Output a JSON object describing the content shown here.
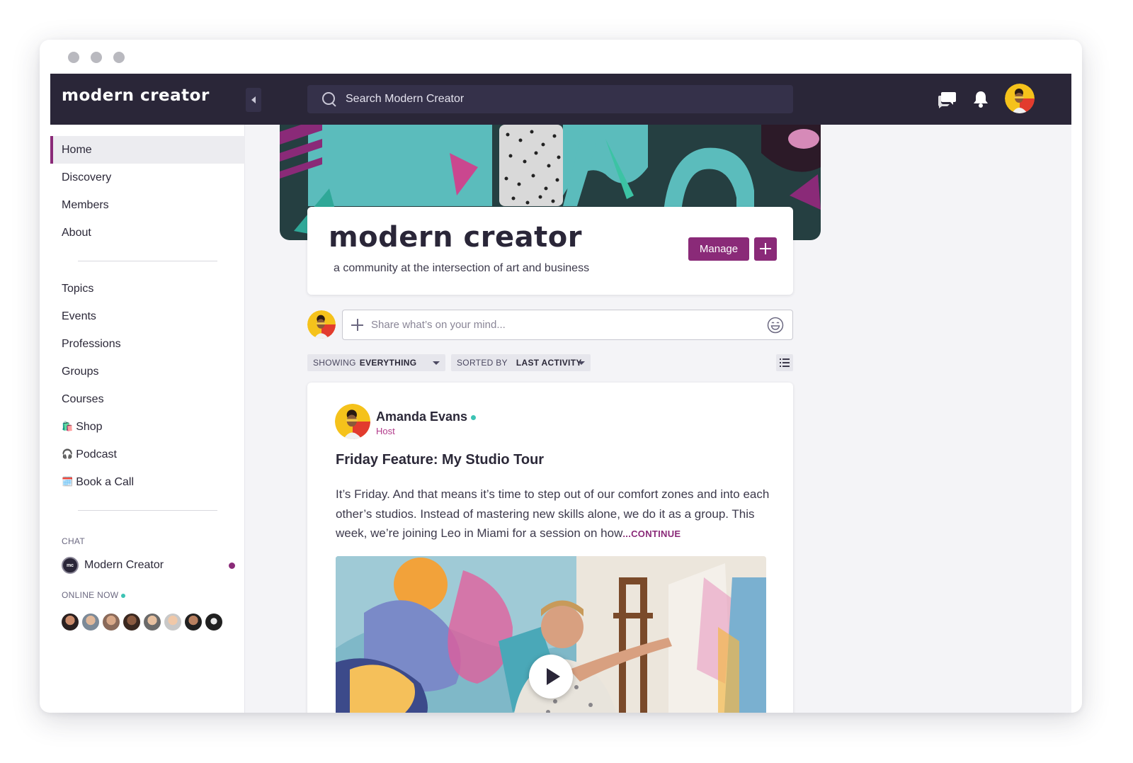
{
  "brand": {
    "logo": "modern creator"
  },
  "search": {
    "placeholder": "Search Modern Creator"
  },
  "sidebar": {
    "items": [
      {
        "label": "Home"
      },
      {
        "label": "Discovery"
      },
      {
        "label": "Members"
      },
      {
        "label": "About"
      },
      {
        "label": "Topics"
      },
      {
        "label": "Events"
      },
      {
        "label": "Professions"
      },
      {
        "label": "Groups"
      },
      {
        "label": "Courses"
      },
      {
        "label": "Shop",
        "emoji": "🛍️"
      },
      {
        "label": "Podcast",
        "emoji": "🎧"
      },
      {
        "label": "Book a Call",
        "emoji": "🗓️"
      }
    ],
    "chat_label": "CHAT",
    "chat_item": "Modern Creator",
    "chat_avatar_text": "mc",
    "online_label": "ONLINE NOW"
  },
  "community": {
    "title": "modern creator",
    "subtitle": "a community at the intersection of art and business",
    "manage_label": "Manage"
  },
  "composer": {
    "placeholder": "Share what’s on your mind..."
  },
  "filters": {
    "showing_label": "SHOWING",
    "showing_value": "EVERYTHING",
    "sorted_label": "SORTED BY",
    "sorted_value": "LAST ACTIVITY"
  },
  "post": {
    "author": "Amanda Evans",
    "role": "Host",
    "title": "Friday Feature: My Studio Tour",
    "body": "It’s Friday. And that means it’s time to step out of our comfort zones and into each other’s studios. Instead of mastering new skills alone, we do it as a group. This week, we’re joining Leo in Miami for a session on how",
    "continue": "...CONTINUE"
  },
  "colors": {
    "topbar": "#2a2638",
    "accent": "#8a2a78",
    "online": "#3cc3b4",
    "banner_teal": "#5bbcbc"
  },
  "icons": [
    "search-icon",
    "chat-bubbles-icon",
    "bell-icon",
    "plus-icon",
    "emoji-icon",
    "list-view-icon",
    "play-icon",
    "chevron-left-icon"
  ]
}
